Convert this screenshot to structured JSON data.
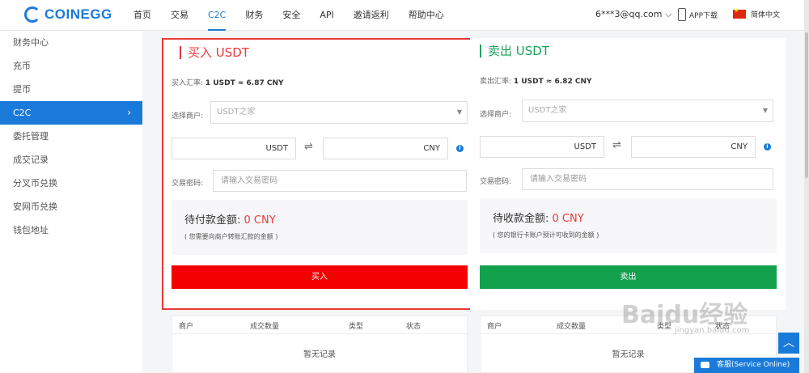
{
  "header": {
    "logo_text": "COINEGG",
    "nav": [
      "首页",
      "交易",
      "C2C",
      "财务",
      "安全",
      "API",
      "邀请返利",
      "帮助中心"
    ],
    "active_nav": "C2C",
    "user": "6***3@qq.com ⌵",
    "app_download": "APP下载",
    "language": "简体中文"
  },
  "sidebar": {
    "items": [
      {
        "label": "财务中心"
      },
      {
        "label": "充币"
      },
      {
        "label": "提币"
      },
      {
        "label": "C2C",
        "active": true
      },
      {
        "label": "委托管理"
      },
      {
        "label": "成交记录"
      },
      {
        "label": "分叉币兑换"
      },
      {
        "label": "安网币兑换"
      },
      {
        "label": "钱包地址"
      }
    ],
    "chevron": "›"
  },
  "buy": {
    "title": "买入 USDT",
    "rate_label": "买入汇率:",
    "rate_value": "1 USDT ≈ 6.87 CNY",
    "merchant_label": "选择商户:",
    "merchant_value": "USDT之家",
    "currency_from": "USDT",
    "currency_to": "CNY",
    "password_label": "交易密码:",
    "password_placeholder": "请输入交易密码",
    "pending_label": "待付款金额:",
    "pending_value": "0 CNY",
    "pending_note": "( 您需要向商户转账汇款的金额 )",
    "button": "买入"
  },
  "sell": {
    "title": "卖出 USDT",
    "rate_label": "卖出汇率:",
    "rate_value": "1 USDT ≈ 6.82 CNY",
    "merchant_label": "选择商户:",
    "merchant_value": "USDT之家",
    "currency_from": "USDT",
    "currency_to": "CNY",
    "password_label": "交易密码:",
    "password_placeholder": "请输入交易密码",
    "pending_label": "待收款金额:",
    "pending_value": "0 CNY",
    "pending_note": "( 您的银行卡账户预计可收到的金额 )",
    "button": "卖出"
  },
  "orders_left": {
    "columns": [
      "商户",
      "成交数量",
      "类型",
      "状态"
    ],
    "empty_text": "暂无记录"
  },
  "orders_right": {
    "columns": [
      "商户",
      "成交数量",
      "类型",
      "状态"
    ],
    "empty_text": "暂无记录"
  },
  "watermark": {
    "text": "Baidu经验",
    "sub": "jingyan.baidu.com"
  },
  "service": {
    "label": "客服(Service Online)"
  },
  "icons": {
    "swap": "⇌",
    "info": "i",
    "dropdown": "▼",
    "to_top": "︿"
  },
  "colors": {
    "brand": "#1a7ad9",
    "buy": "#f50000",
    "sell": "#13a14d",
    "highlight_border": "#e8393a"
  }
}
